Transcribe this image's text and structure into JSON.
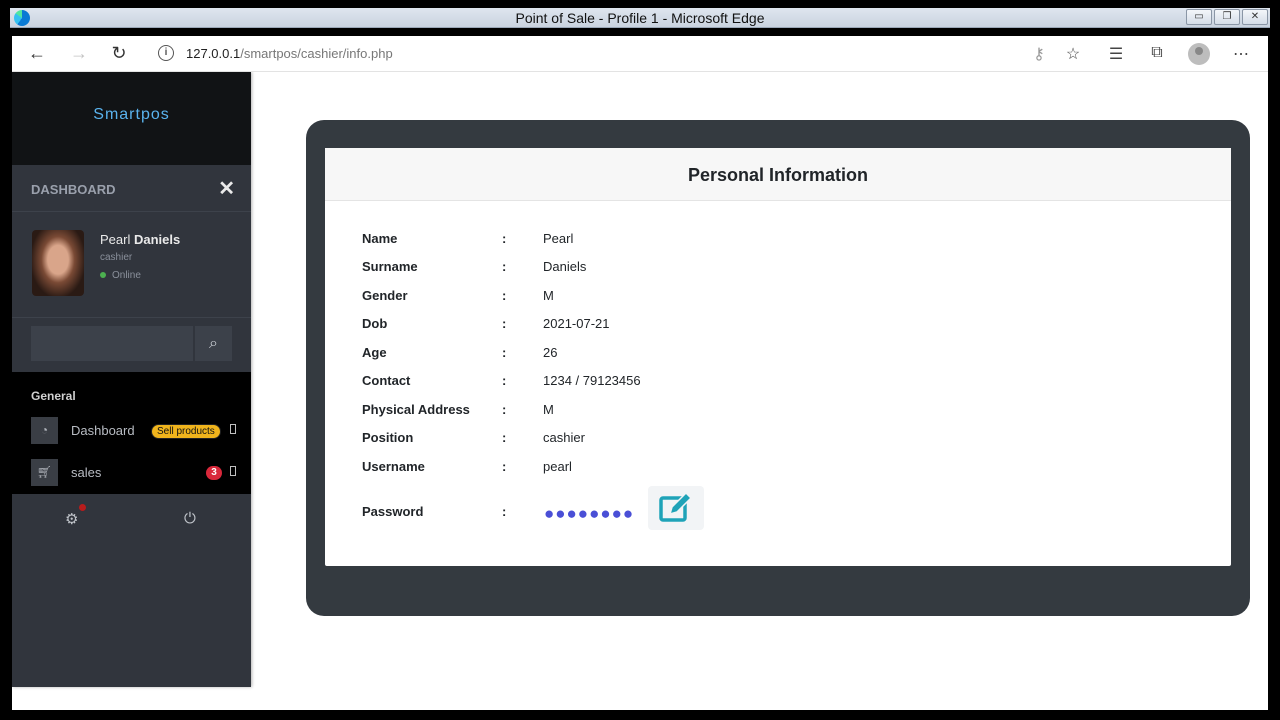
{
  "window": {
    "title": "Point of Sale - Profile 1 - Microsoft Edge"
  },
  "browser": {
    "url_host": "127.0.0.1",
    "url_path": "/smartpos/cashier/info.php"
  },
  "sidebar": {
    "brand": "Smartpos",
    "section_label": "DASHBOARD",
    "user": {
      "first_name": "Pearl",
      "last_name": "Daniels",
      "role": "cashier",
      "status": "Online"
    },
    "search": {
      "placeholder": ""
    },
    "group_label": "General",
    "items": [
      {
        "label": "Dashboard",
        "badge": "Sell products",
        "icon": "gauge-icon"
      },
      {
        "label": "sales",
        "badge": "3",
        "icon": "cart-icon"
      }
    ]
  },
  "card": {
    "title": "Personal Information",
    "rows": [
      {
        "label": "Name",
        "value": "Pearl"
      },
      {
        "label": "Surname",
        "value": "Daniels"
      },
      {
        "label": "Gender",
        "value": "M"
      },
      {
        "label": "Dob",
        "value": "2021-07-21"
      },
      {
        "label": "Age",
        "value": "26"
      },
      {
        "label": "Contact",
        "value": "1234 / 79123456"
      },
      {
        "label": "Physical Address",
        "value": "M"
      },
      {
        "label": "Position",
        "value": "cashier"
      },
      {
        "label": "Username",
        "value": "pearl"
      }
    ],
    "password": {
      "label": "Password",
      "masked": "●●●●●●●●"
    },
    "separator": ":"
  },
  "colors": {
    "accent_edit": "#1fa3b8",
    "online": "#4cb050",
    "badge_yellow": "#f0b41c",
    "badge_red": "#d9283b",
    "brand": "#5ab3ee"
  }
}
